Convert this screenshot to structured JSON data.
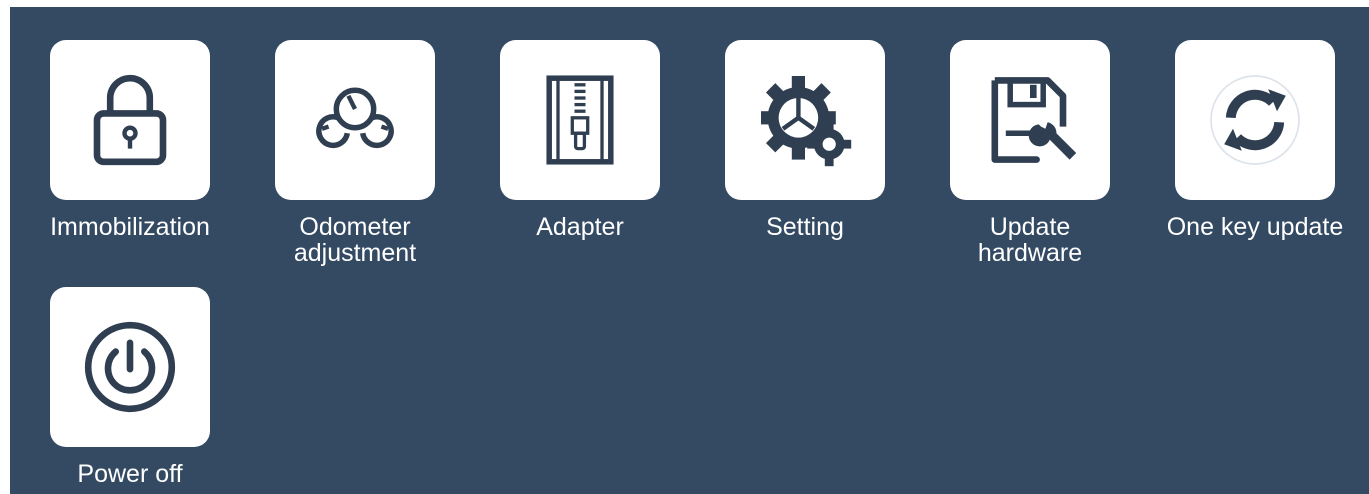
{
  "screen": {
    "background_color": "#344a63",
    "tile_color": "#ffffff",
    "icon_color": "#2f3e50"
  },
  "apps": [
    {
      "label": "Immobilization",
      "icon": "padlock-icon"
    },
    {
      "label": "Odometer\nadjustment",
      "icon": "odometer-gauges-icon"
    },
    {
      "label": "Adapter",
      "icon": "zipper-adapter-icon"
    },
    {
      "label": "Setting",
      "icon": "gears-icon"
    },
    {
      "label": "Update\nhardware",
      "icon": "floppy-wrench-icon"
    },
    {
      "label": "One key update",
      "icon": "refresh-arrows-icon"
    },
    {
      "label": "Power off",
      "icon": "power-icon"
    }
  ]
}
